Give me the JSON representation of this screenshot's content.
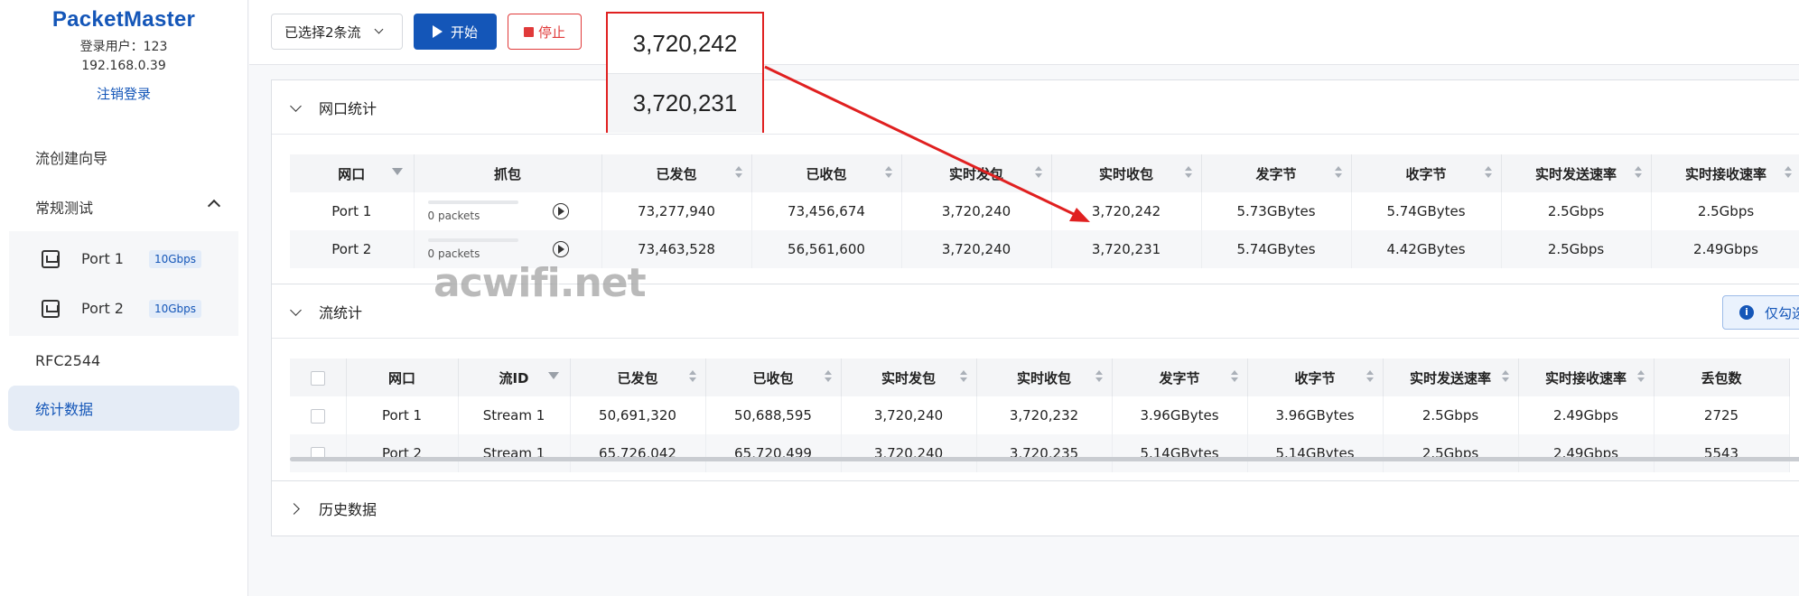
{
  "sidebar": {
    "logo": "PacketMaster",
    "user_line": "登录用户：123",
    "ip": "192.168.0.39",
    "logout": "注销登录",
    "nav": {
      "wizard": "流创建向导",
      "regular": "常规测试",
      "ports": [
        {
          "label": "Port 1",
          "speed": "10Gbps"
        },
        {
          "label": "Port 2",
          "speed": "10Gbps"
        }
      ],
      "rfc": "RFC2544",
      "stats": "统计数据"
    }
  },
  "toolbar": {
    "select_label": "已选择2条流",
    "start_label": "开始",
    "stop_label": "停止"
  },
  "port_stats": {
    "title": "网口统计",
    "headers": [
      "网口",
      "抓包",
      "已发包",
      "已收包",
      "实时发包",
      "实时收包",
      "发字节",
      "收字节",
      "实时发送速率",
      "实时接收速率"
    ],
    "rows": [
      {
        "port": "Port 1",
        "capture": "0 packets",
        "sent": "73,277,940",
        "recv": "73,456,674",
        "rt_sent": "3,720,240",
        "rt_recv": "3,720,242",
        "tx_bytes": "5.73GBytes",
        "rx_bytes": "5.74GBytes",
        "tx_rate": "2.5Gbps",
        "rx_rate": "2.5Gbps"
      },
      {
        "port": "Port 2",
        "capture": "0 packets",
        "sent": "73,463,528",
        "recv": "56,561,600",
        "rt_sent": "3,720,240",
        "rt_recv": "3,720,231",
        "tx_bytes": "5.74GBytes",
        "rx_bytes": "4.42GBytes",
        "tx_rate": "2.5Gbps",
        "rx_rate": "2.49Gbps"
      }
    ]
  },
  "flow_stats": {
    "title": "流统计",
    "info_button": "仅勾选",
    "headers": [
      "网口",
      "流ID",
      "已发包",
      "已收包",
      "实时发包",
      "实时收包",
      "发字节",
      "收字节",
      "实时发送速率",
      "实时接收速率",
      "丢包数"
    ],
    "rows": [
      {
        "port": "Port 1",
        "flow": "Stream 1",
        "sent": "50,691,320",
        "recv": "50,688,595",
        "rt_sent": "3,720,240",
        "rt_recv": "3,720,232",
        "tx_bytes": "3.96GBytes",
        "rx_bytes": "3.96GBytes",
        "tx_rate": "2.5Gbps",
        "rx_rate": "2.49Gbps",
        "loss": "2725"
      },
      {
        "port": "Port 2",
        "flow": "Stream 1",
        "sent": "65,726,042",
        "recv": "65,720,499",
        "rt_sent": "3,720,240",
        "rt_recv": "3,720,235",
        "tx_bytes": "5.14GBytes",
        "rx_bytes": "5.14GBytes",
        "tx_rate": "2.5Gbps",
        "rx_rate": "2.49Gbps",
        "loss": "5543"
      }
    ]
  },
  "history": {
    "title": "历史数据"
  },
  "callout": {
    "value1": "3,720,242",
    "value2": "3,720,231"
  },
  "watermark": "acwifi.net",
  "colors": {
    "brand": "#1456b8",
    "stop": "#e03a3a",
    "annotation": "#e02020"
  }
}
